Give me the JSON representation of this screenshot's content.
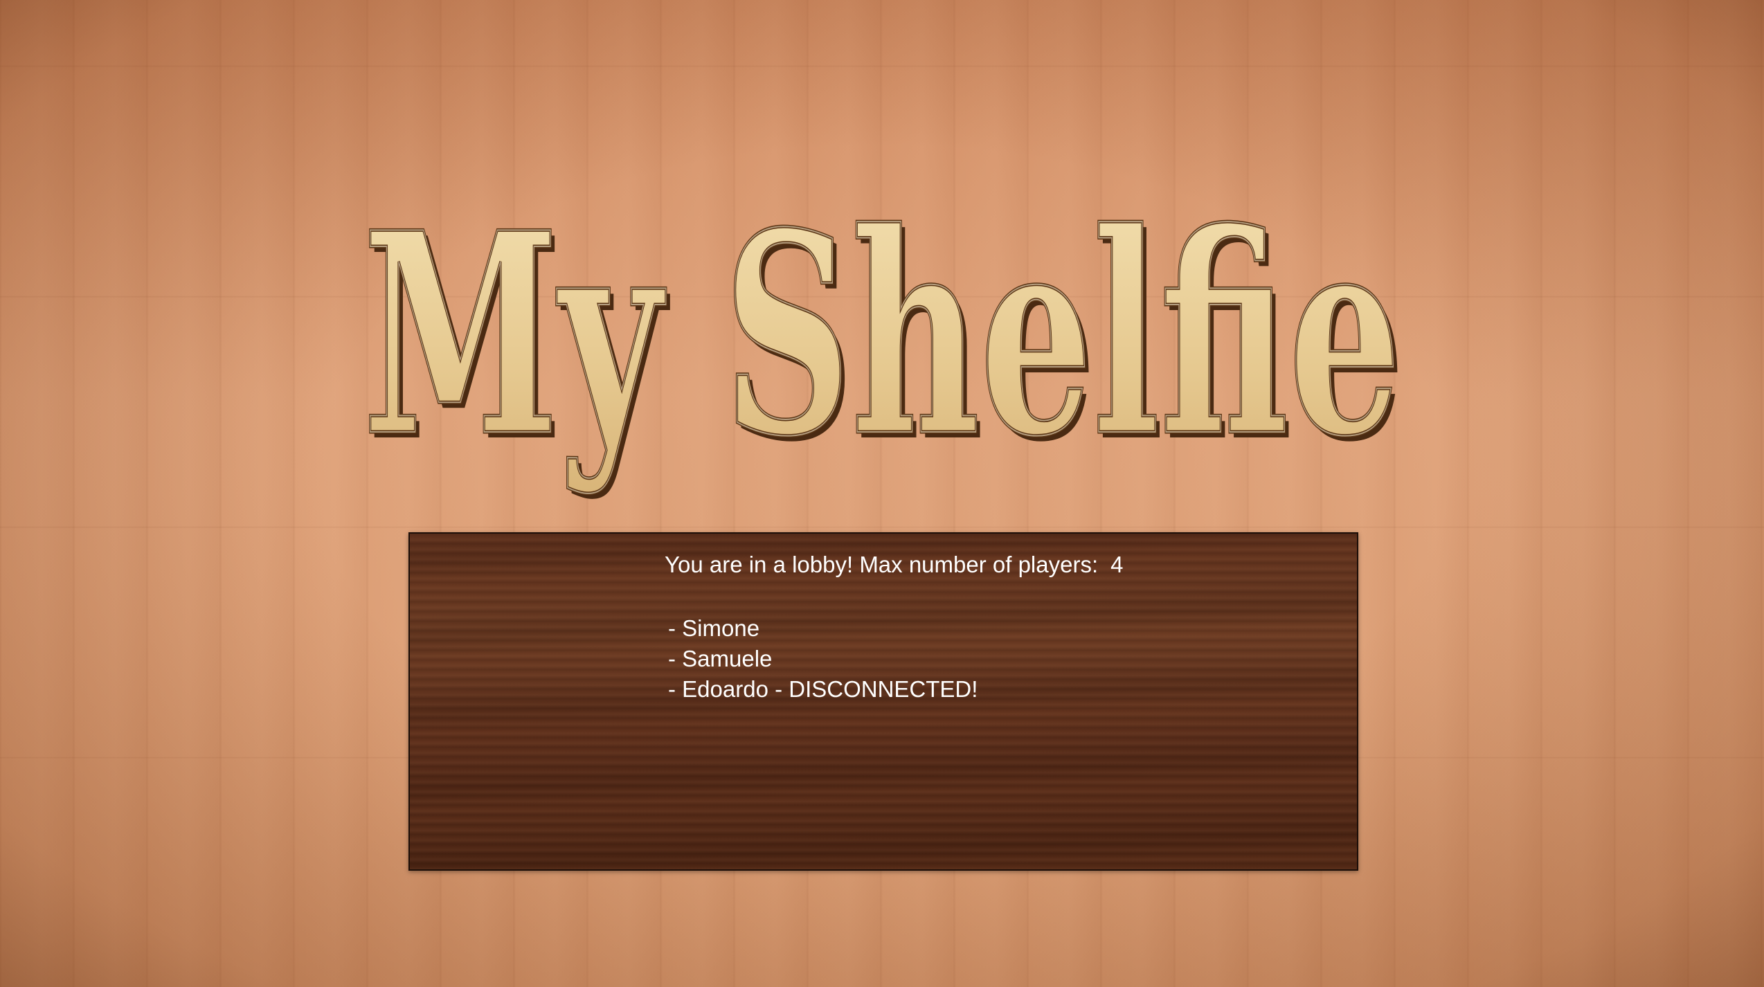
{
  "game": {
    "logo_text": "My Shelfie"
  },
  "lobby": {
    "title": "You are in a lobby! Max number of players:",
    "max_players": "4",
    "players": [
      {
        "label": "- Simone"
      },
      {
        "label": "- Samuele"
      },
      {
        "label": "- Edoardo - DISCONNECTED!"
      }
    ]
  },
  "colors": {
    "floor": "#d89a72",
    "panel": "#5e301c",
    "logo_fill": "#e8cc94",
    "logo_outline": "#4a2a12",
    "text": "#ffffff"
  }
}
